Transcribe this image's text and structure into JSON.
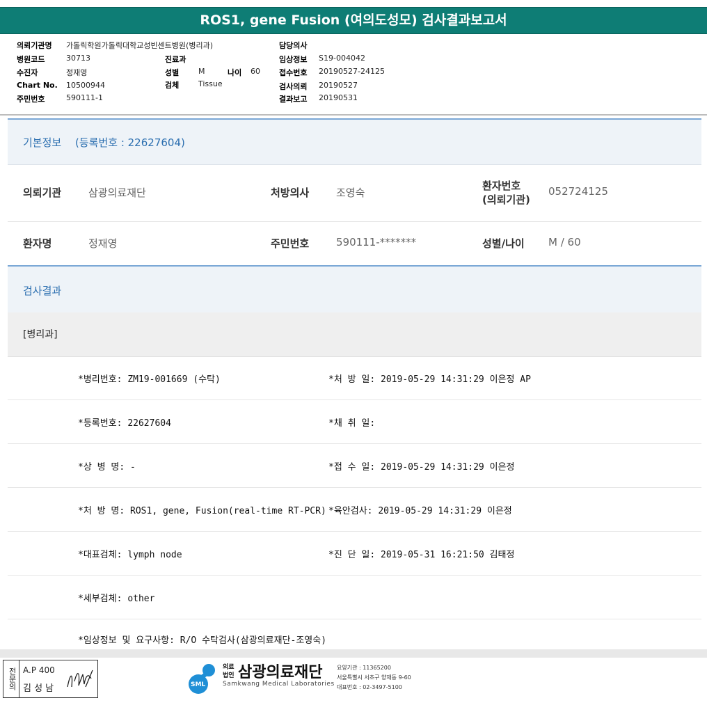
{
  "title": "ROS1, gene Fusion (여의도성모) 검사결과보고서",
  "header": {
    "institution_label": "의뢰기관명",
    "institution": "가톨릭학원가톨릭대학교성빈센트병원(병리과)",
    "hospital_code_label": "병원코드",
    "hospital_code": "30713",
    "patient_label": "수진자",
    "patient": "정재영",
    "chart_label": "Chart No.",
    "chart": "10500944",
    "resident_label": "주민번호",
    "resident": "590111-1",
    "dept_label": "진료과",
    "dept": "",
    "sex_label": "성별",
    "sex": "M",
    "age_label": "나이",
    "age": "60",
    "specimen_label": "검체",
    "specimen": "Tissue",
    "doctor_label": "담당의사",
    "doctor": "",
    "clinical_label": "임상정보",
    "clinical": "S19-004042",
    "receipt_label": "접수번호",
    "receipt": "20190527-24125",
    "req_label": "검사의뢰",
    "req": "20190527",
    "report_label": "결과보고",
    "report": "20190531"
  },
  "basic": {
    "title": "기본정보",
    "reg": "(등록번호 : 22627604)",
    "inst_label": "의뢰기관",
    "inst": "삼광의료재단",
    "presc_label": "처방의사",
    "presc": "조영숙",
    "pno_label_1": "환자번호",
    "pno_label_2": "(의뢰기관)",
    "pno": "052724125",
    "pname_label": "환자명",
    "pname": "정재영",
    "rrn_label": "주민번호",
    "rrn": "590111-*******",
    "sexage_label": "성별/나이",
    "sexage": "M / 60"
  },
  "result": {
    "title": "검사결과",
    "dept": "[병리과]",
    "rows": [
      {
        "left": "*병리번호: ZM19-001669 (수탁)",
        "right": "*처 방 일: 2019-05-29 14:31:29  이은정 AP"
      },
      {
        "left": "*등록번호: 22627604",
        "right": "*채 취 일:"
      },
      {
        "left": "*상 병 명: -",
        "right": "*접 수 일: 2019-05-29 14:31:29  이은정"
      },
      {
        "left": "*처 방 명: ROS1, gene, Fusion(real-time RT-PCR)",
        "right": "*육안검사: 2019-05-29 14:31:29  이은정"
      },
      {
        "left": "*대표검체: lymph node",
        "right": "*진 단 일: 2019-05-31 16:21:50  김태정"
      },
      {
        "left": "*세부검체: other",
        "right": ""
      },
      {
        "left": "*임상정보 및 요구사항: R/O 수탁검사(삼광의료재단-조영숙)",
        "right": ""
      }
    ]
  },
  "footer": {
    "stamp_vertical": "전문의",
    "stamp_line1": "A.P 400",
    "stamp_line2": "김 성 남",
    "org_prefix_1": "의료",
    "org_prefix_2": "법인",
    "org_name": "삼광의료재단",
    "org_en": "Samkwang Medical Laboratories",
    "sml": "SML",
    "info1": "요양기관 : 11365200",
    "info2": "서울특별시 서초구 양재동 9-60",
    "info3": "대표번호 : 02-3497-5100"
  }
}
